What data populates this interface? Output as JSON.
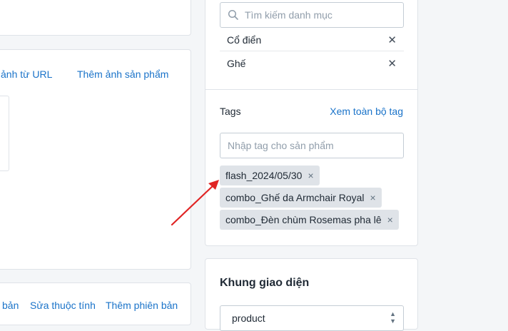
{
  "left_panel": {
    "media_links": {
      "url_image": "ảnh từ URL",
      "add_product_image": "Thêm ảnh sản phẩm"
    },
    "variant_links": {
      "partial": "bản",
      "edit_attributes": "Sửa thuộc tính",
      "add_variant": "Thêm phiên bản"
    }
  },
  "categories": {
    "search_placeholder": "Tìm kiếm danh mục",
    "items": [
      {
        "label": "Cổ điển"
      },
      {
        "label": "Ghế"
      }
    ],
    "remove_icon": "close-icon"
  },
  "tags": {
    "title": "Tags",
    "view_all": "Xem toàn bộ tag",
    "input_placeholder": "Nhập tag cho sản phẩm",
    "items": [
      {
        "label": "flash_2024/05/30"
      },
      {
        "label": "combo_Ghế da Armchair Royal"
      },
      {
        "label": "combo_Đèn chùm Rosemas pha lê"
      }
    ],
    "remove_glyph": "×"
  },
  "theme_frame": {
    "title": "Khung giao diện",
    "selected_value": "product"
  },
  "annotation": {
    "arrow_color": "#e02424"
  }
}
